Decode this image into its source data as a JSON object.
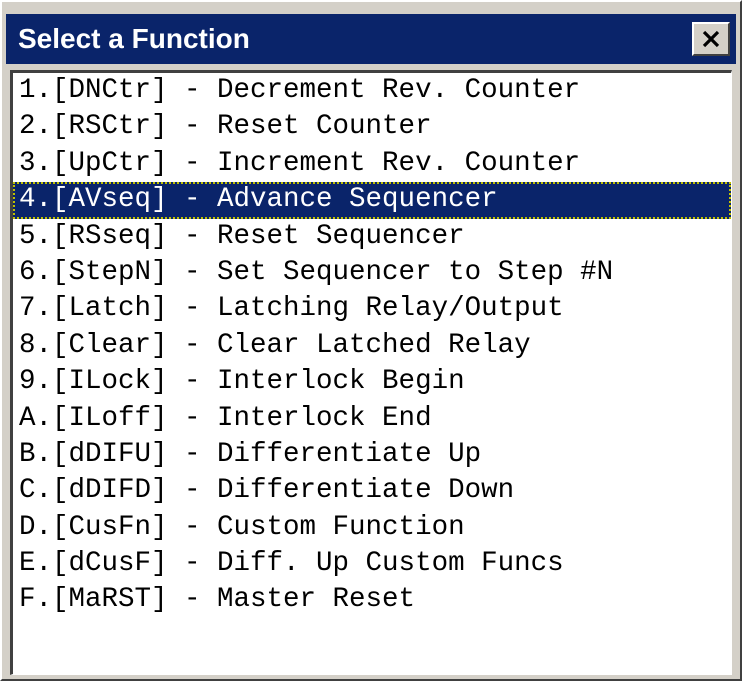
{
  "window": {
    "title": "Select a Function",
    "close_label": "close"
  },
  "list": {
    "selected_index": 3,
    "items": [
      "1.[DNCtr] - Decrement Rev. Counter",
      "2.[RSCtr] - Reset Counter",
      "3.[UpCtr] - Increment Rev. Counter",
      "4.[AVseq] - Advance Sequencer",
      "5.[RSseq] - Reset Sequencer",
      "6.[StepN] - Set Sequencer to Step #N",
      "7.[Latch] - Latching Relay/Output",
      "8.[Clear] - Clear Latched Relay",
      "9.[ILock] - Interlock Begin",
      "A.[ILoff] - Interlock End",
      "B.[dDIFU] - Differentiate Up",
      "C.[dDIFD] - Differentiate Down",
      "D.[CusFn] - Custom Function",
      "E.[dCusF] - Diff. Up Custom Funcs",
      "F.[MaRST] - Master Reset"
    ]
  },
  "colors": {
    "titlebar": "#0a246a",
    "selection": "#0a246a",
    "face": "#d4d0c8"
  }
}
